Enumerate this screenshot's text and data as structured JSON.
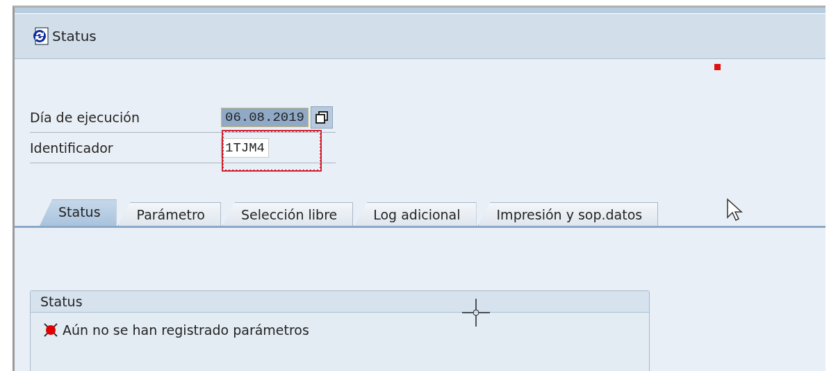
{
  "title_bar": {
    "title": "Status"
  },
  "fields": [
    {
      "label": "Día de ejecución",
      "value": "06.08.2019",
      "kind": "date"
    },
    {
      "label": "Identificador",
      "value": "1TJM4",
      "kind": "text"
    }
  ],
  "tabs": [
    {
      "label": "Status",
      "selected": true
    },
    {
      "label": "Parámetro",
      "selected": false
    },
    {
      "label": "Selección libre",
      "selected": false
    },
    {
      "label": "Log adicional",
      "selected": false
    },
    {
      "label": "Impresión y sop.datos",
      "selected": false
    }
  ],
  "status_group": {
    "title": "Status",
    "message": "Aún no se han registrado parámetros",
    "color": "#e00000"
  }
}
